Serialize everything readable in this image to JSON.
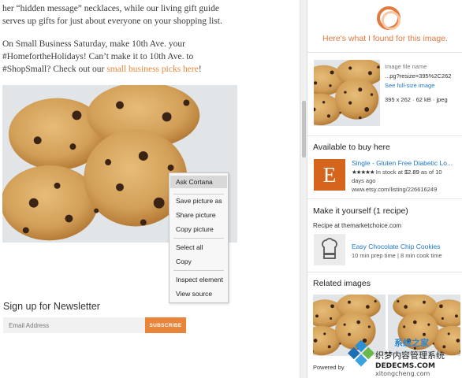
{
  "article": {
    "p1": "her “hidden message” necklaces, while our living gift guide serves up gifts for just about everyone on your shopping list.",
    "p2_before": "On Small Business Saturday, make 10th Ave. your #HomefortheHolidays! Can’t make it to 10th Ave. to #ShopSmall? Check out our ",
    "p2_link": "small business picks here",
    "p2_after": "!",
    "newsletter_title": "Sign up for Newsletter",
    "email_placeholder": "Email Address",
    "subscribe_label": "SUBSCRIBE"
  },
  "context_menu": {
    "items": [
      "Ask Cortana",
      "Save picture as",
      "Share picture",
      "Copy picture",
      "Select all",
      "Copy",
      "Inspect element",
      "View source"
    ],
    "highlighted": "Ask Cortana"
  },
  "cortana": {
    "heading": "Here's what I found for this image.",
    "file": {
      "label": "Image file name",
      "name": "...pg?resize=395%2C262",
      "full_size_link": "See full-size image",
      "meta": "395 x 262 · 62 kB · jpeg"
    },
    "buy": {
      "section": "Available to buy here",
      "logo_letter": "E",
      "title": "Single - Gluten Free Diabetic Lo...",
      "stars": "★★★★★",
      "stock_prefix": "In stock at ",
      "price": "$2.89",
      "stock_suffix": " as of 10",
      "when": "days ago",
      "url": "www.etsy.com/listing/226616249"
    },
    "recipe": {
      "section": "Make it yourself (1 recipe)",
      "source": "Recipe at themarketchoice.com",
      "title": "Easy Chocolate Chip Cookies",
      "time": "10 min prep time | 8 min cook time"
    },
    "related": {
      "section": "Related images"
    },
    "powered_by": "Powered by"
  },
  "watermark": {
    "line1": "系统之家",
    "line2": "织梦内容管理系统",
    "line3": "DEDECMS.COM",
    "line4": "xitongcheng.com"
  },
  "colors": {
    "accent_orange": "#e8853a",
    "cortana_orange": "#e27a3f",
    "link_blue": "#1f78c8",
    "etsy_orange": "#d5641c"
  }
}
